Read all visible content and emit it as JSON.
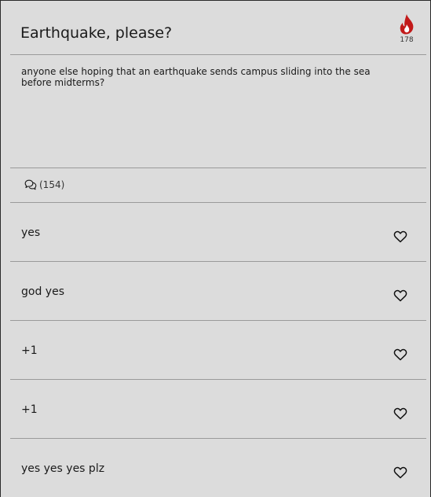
{
  "post": {
    "title": "Earthquake, please?",
    "heat": "178",
    "body": "anyone else hoping that an earthquake sends campus sliding into the sea before midterms?",
    "comments_label": "(154)"
  },
  "replies": [
    {
      "text": "yes"
    },
    {
      "text": "god yes"
    },
    {
      "text": "+1"
    },
    {
      "text": "+1"
    },
    {
      "text": "yes yes yes plz"
    }
  ],
  "colors": {
    "background": "#dcdcdc",
    "flame": "#c21a1a",
    "divider": "#9a9a9a"
  },
  "icons": {
    "heat": "flame-icon",
    "comments": "speech-bubbles-icon",
    "like": "heart-outline-icon"
  }
}
